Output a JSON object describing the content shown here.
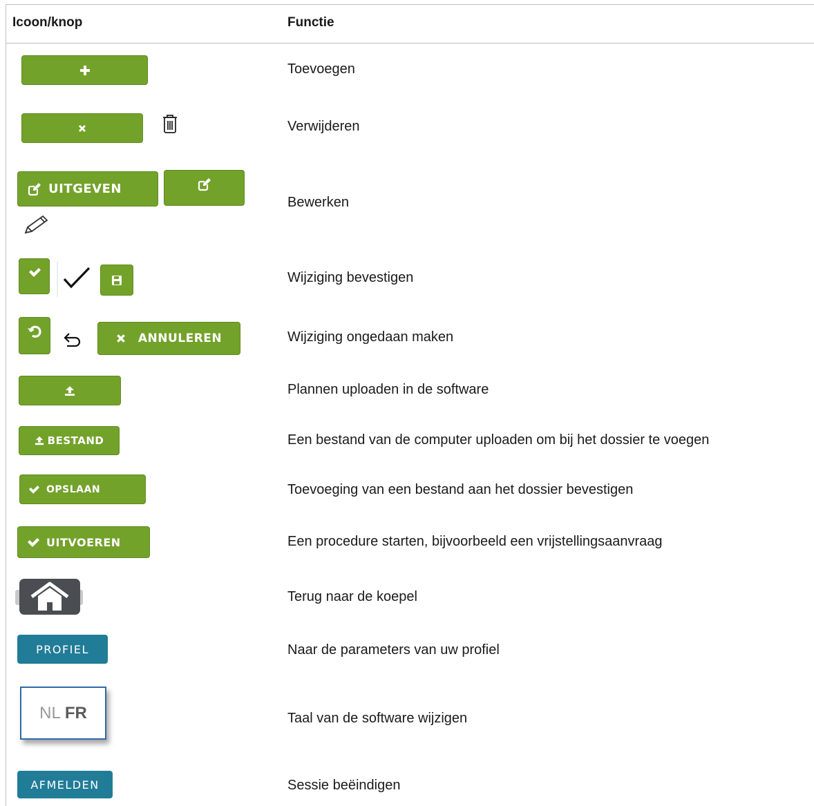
{
  "header": {
    "col_icon": "Icoon/knop",
    "col_function": "Functie"
  },
  "rows": [
    {
      "function": "Toevoegen"
    },
    {
      "function": "Verwijderen"
    },
    {
      "function": "Bewerken"
    },
    {
      "function": "Wijziging bevestigen"
    },
    {
      "function": "Wijziging ongedaan maken"
    },
    {
      "function": "Plannen uploaden in de software"
    },
    {
      "function": "Een bestand van de computer uploaden om bij het dossier te voegen"
    },
    {
      "function": "Toevoeging van een bestand aan het dossier bevestigen"
    },
    {
      "function": "Een procedure starten, bijvoorbeeld een vrijstellingsaanvraag"
    },
    {
      "function": "Terug naar de koepel"
    },
    {
      "function": "Naar de parameters van uw profiel"
    },
    {
      "function": "Taal van de software wijzigen"
    },
    {
      "function": "Sessie beëindigen"
    }
  ],
  "buttons": {
    "edit_label": "UITGEVEN",
    "cancel_label": "ANNULEREN",
    "file_label": "BESTAND",
    "save_label": "OPSLAAN",
    "execute_label": "UITVOEREN",
    "profile_label": "PROFIEL",
    "lang_nl": "NL",
    "lang_fr": "FR",
    "logout_label": "AFMELDEN"
  },
  "colors": {
    "green": "#73a22b",
    "blue": "#217c98",
    "dark": "#4a4d52"
  },
  "icons": [
    "plus-icon",
    "times-icon",
    "trash-icon",
    "edit-icon",
    "pencil-icon",
    "check-icon",
    "save-icon",
    "undo-icon",
    "upload-icon",
    "home-icon"
  ]
}
